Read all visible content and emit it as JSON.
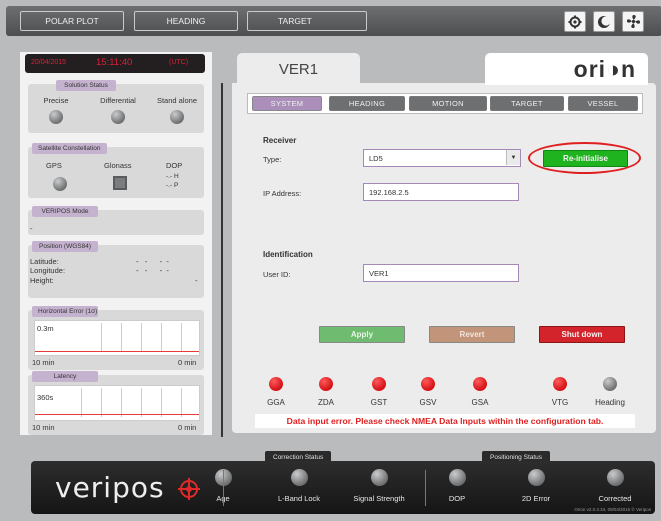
{
  "topnav": {
    "polar_plot": "POLAR PLOT",
    "heading": "HEADING",
    "target": "TARGET",
    "icons": [
      "gear-icon",
      "moon-icon",
      "fan-icon"
    ]
  },
  "timebar": {
    "date": "20/04/2015",
    "time": "15:11:40",
    "zone": "(UTC)"
  },
  "solution_status": {
    "title": "Solution Status",
    "labels": [
      "Precise",
      "Differential",
      "Stand alone"
    ]
  },
  "satellite": {
    "title": "Satellite Constellation",
    "gps": "GPS",
    "glonass": "Glonass",
    "dop": "DOP",
    "dop_h": "-.- H",
    "dop_p": "-.- P"
  },
  "veripos_mode": {
    "title": "VERIPOS Mode",
    "value": "-"
  },
  "position": {
    "title": "Position (WGS84)",
    "latitude_label": "Latitude:",
    "latitude_value": "-   -      -  -",
    "longitude_label": "Longitude:",
    "longitude_value": "-   -      -  -",
    "height_label": "Height:",
    "height_value": "-"
  },
  "horizontal_error": {
    "title": "Horizontal Error (1σ)",
    "y_label": "0.3m",
    "left": "10 min",
    "right": "0 min"
  },
  "latency": {
    "title": "Latency",
    "y_label": "360s",
    "left": "10 min",
    "right": "0 min"
  },
  "main": {
    "vessel_tab": "VER1",
    "logo": "ori◑n",
    "tabs": [
      "SYSTEM",
      "HEADING",
      "MOTION",
      "TARGET",
      "VESSEL"
    ],
    "receiver": {
      "heading": "Receiver",
      "type_label": "Type:",
      "type_value": "LD5",
      "ip_label": "IP Address:",
      "ip_value": "192.168.2.5",
      "reinit": "Re-initialise"
    },
    "identification": {
      "heading": "Identification",
      "user_label": "User ID:",
      "user_value": "VER1"
    },
    "buttons": {
      "apply": "Apply",
      "revert": "Revert",
      "shutdown": "Shut down"
    },
    "leds": [
      {
        "label": "GGA",
        "state": "red"
      },
      {
        "label": "ZDA",
        "state": "red"
      },
      {
        "label": "GST",
        "state": "red"
      },
      {
        "label": "GSV",
        "state": "red"
      },
      {
        "label": "GSA",
        "state": "red"
      },
      {
        "label": "VTG",
        "state": "red"
      },
      {
        "label": "Heading",
        "state": "grey"
      }
    ],
    "error_text": "Data input error. Please check NMEA Data Inputs within the configuration tab."
  },
  "footer": {
    "brand": "veripos",
    "correction_status": "Correction Status",
    "positioning_status": "Positioning Status",
    "indicators": [
      "Age",
      "L-Band Lock",
      "Signal Strength",
      "DOP",
      "2D Error",
      "Corrected"
    ],
    "version": "Orion v2.0.3.34, 09/04/2015 © Veripos"
  },
  "colors": {
    "accent": "#ab8fba",
    "green": "#1fb31f",
    "led_red": "#d6151b"
  }
}
